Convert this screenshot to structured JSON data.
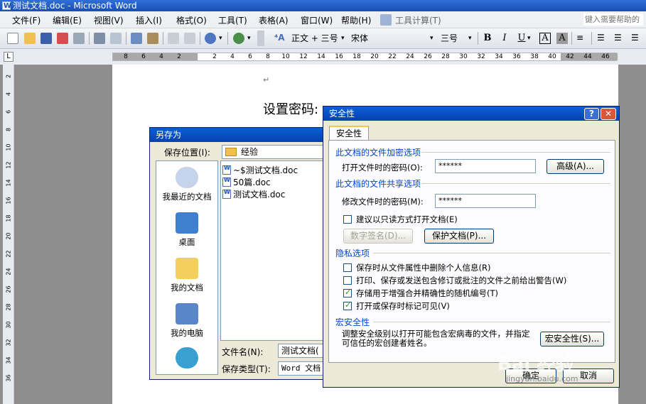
{
  "window": {
    "title": "测试文档.doc - Microsoft Word"
  },
  "menubar": {
    "items": [
      "文件(F)",
      "编辑(E)",
      "视图(V)",
      "插入(I)",
      "格式(O)",
      "工具(T)",
      "表格(A)",
      "窗口(W)",
      "帮助(H)",
      "工具计算(T)"
    ],
    "help_placeholder": "键入需要帮助的"
  },
  "toolbar": {
    "style_combo": "正文 + 三号",
    "font_combo": "宋体",
    "size_combo": "三号",
    "bold": "B",
    "italic": "I",
    "underline": "U",
    "char_border": "A",
    "char_shade": "A"
  },
  "ruler": {
    "horizontal_ticks": [
      "8",
      "6",
      "4",
      "2",
      "2",
      "4",
      "6",
      "8",
      "10",
      "12",
      "14",
      "16",
      "18",
      "20",
      "22",
      "24",
      "26",
      "28",
      "30",
      "32",
      "34",
      "36",
      "38",
      "40",
      "42",
      "44",
      "46"
    ],
    "vertical_ticks": [
      "2",
      "4",
      "6",
      "8",
      "10",
      "12",
      "14",
      "16",
      "18",
      "20",
      "22",
      "24",
      "26",
      "28",
      "30",
      "32",
      "34",
      "36"
    ]
  },
  "document": {
    "paragraph_mark": "↵",
    "heading": "设置密码:"
  },
  "saveas_dialog": {
    "title": "另存为",
    "location_label": "保存位置(I):",
    "location_value": "经验",
    "places": [
      "我最近的文档",
      "桌面",
      "我的文档",
      "我的电脑"
    ],
    "files": [
      "~$测试文档.doc",
      "50篇.doc",
      "测试文档.doc"
    ],
    "filename_label": "文件名(N):",
    "filename_value": "测试文档(",
    "filetype_label": "保存类型(T):",
    "filetype_value": "Word 文档"
  },
  "security_dialog": {
    "title": "安全性",
    "help_btn": "?",
    "close_btn": "✕",
    "tab": "安全性",
    "encrypt_header": "此文档的文件加密选项",
    "open_pwd_label": "打开文件时的密码(O):",
    "open_pwd_value": "******",
    "advanced_btn": "高级(A)...",
    "share_header": "此文档的文件共享选项",
    "modify_pwd_label": "修改文件时的密码(M):",
    "modify_pwd_value": "******",
    "readonly_label": "建议以只读方式打开文档(E)",
    "readonly_checked": false,
    "digital_sig_btn": "数字签名(D)...",
    "protect_doc_btn": "保护文档(P)...",
    "privacy_header": "隐私选项",
    "privacy_options": [
      {
        "label": "保存时从文件属性中删除个人信息(R)",
        "checked": false
      },
      {
        "label": "打印、保存或发送包含修订或批注的文件之前给出警告(W)",
        "checked": false
      },
      {
        "label": "存储用于增强合并精确性的随机编号(T)",
        "checked": true
      },
      {
        "label": "打开或保存时标记可见(V)",
        "checked": true
      }
    ],
    "macro_header": "宏安全性",
    "macro_desc": "调整安全级别以打开可能包含宏病毒的文件，并指定可信任的宏创建者姓名。",
    "macro_btn": "宏安全性(S)...",
    "ok_btn": "确定",
    "cancel_btn": "取消"
  },
  "watermark": {
    "text": "Bai 经验",
    "sub": "jingyan.baidu.com"
  }
}
